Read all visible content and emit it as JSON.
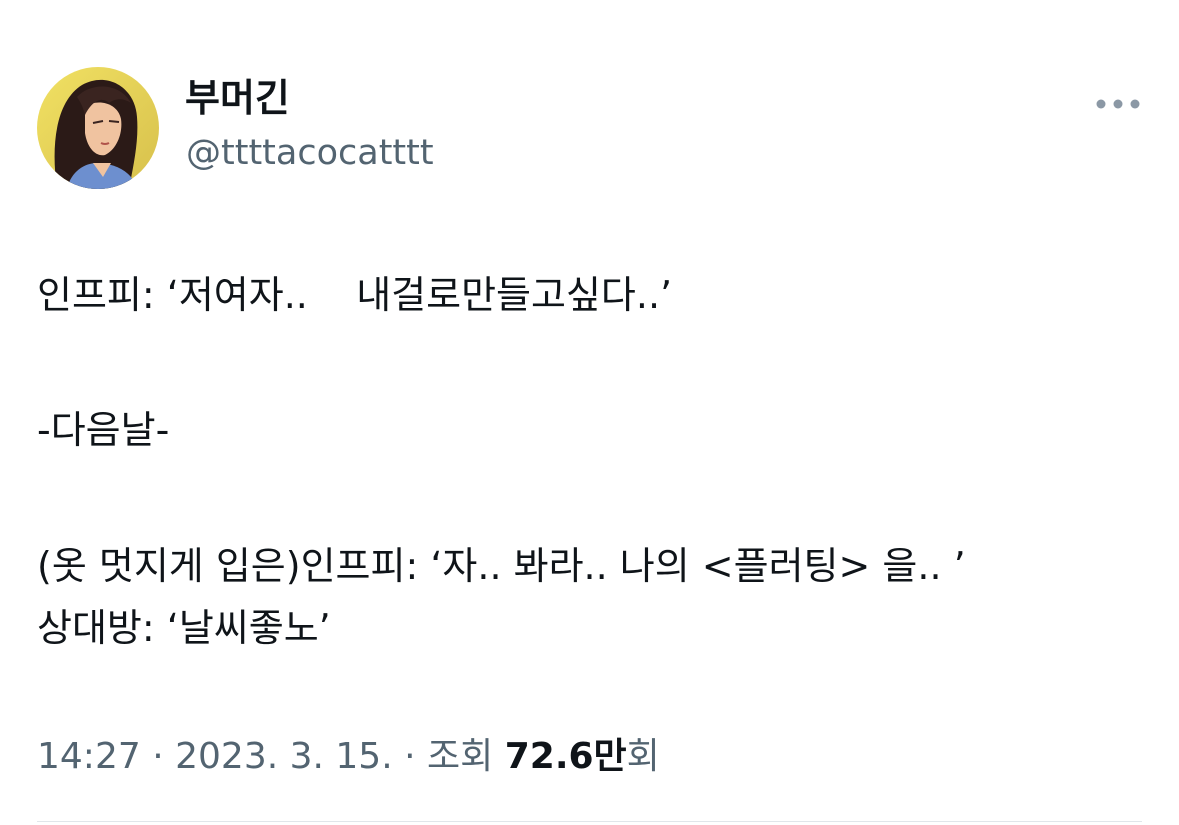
{
  "author": {
    "display_name": "부머긴",
    "handle": "@ttttacocatttt",
    "avatar_icon": "anime-character-portrait"
  },
  "more_icon": "more-horizontal-icon",
  "tweet": {
    "lines": [
      "인프피: ‘저여자..    내걸로만들고싶다..’",
      "-다음날-",
      "(옷 멋지게 입은)인프피: ‘자.. 봐라.. 나의 <플러팅> 을.. ’",
      "상대방: ‘날씨좋노’"
    ]
  },
  "meta": {
    "time": "14:27",
    "separator": "·",
    "date": "2023. 3. 15.",
    "views_label": "조회",
    "views_count": "72.6만",
    "views_suffix": "회"
  },
  "colors": {
    "text_primary": "#0f1419",
    "text_secondary": "#536471",
    "divider": "#e1e6ea"
  }
}
